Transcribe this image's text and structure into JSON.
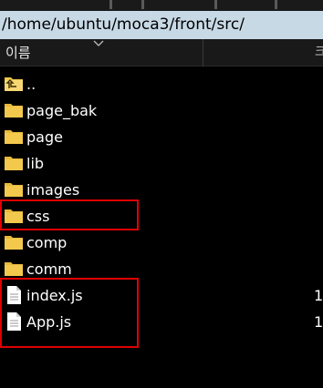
{
  "path": "/home/ubuntu/moca3/front/src/",
  "columns": {
    "name": "이름",
    "second_partial": "크"
  },
  "files": [
    {
      "label": "..",
      "icon": "folder-up-icon",
      "size": ""
    },
    {
      "label": "page_bak",
      "icon": "folder-icon",
      "size": ""
    },
    {
      "label": "page",
      "icon": "folder-icon",
      "size": ""
    },
    {
      "label": "lib",
      "icon": "folder-icon",
      "size": ""
    },
    {
      "label": "images",
      "icon": "folder-icon",
      "size": ""
    },
    {
      "label": "css",
      "icon": "folder-icon",
      "size": ""
    },
    {
      "label": "comp",
      "icon": "folder-icon",
      "size": ""
    },
    {
      "label": "comm",
      "icon": "folder-icon",
      "size": ""
    },
    {
      "label": "index.js",
      "icon": "file-icon",
      "size": "1"
    },
    {
      "label": "App.js",
      "icon": "file-icon",
      "size": "1"
    }
  ],
  "highlights": [
    "css",
    "index.js",
    "App.js"
  ],
  "colors": {
    "background": "#000000",
    "path_bar": "#c8d9e6",
    "folder": "#f2c94c",
    "highlight": "#e00000"
  }
}
